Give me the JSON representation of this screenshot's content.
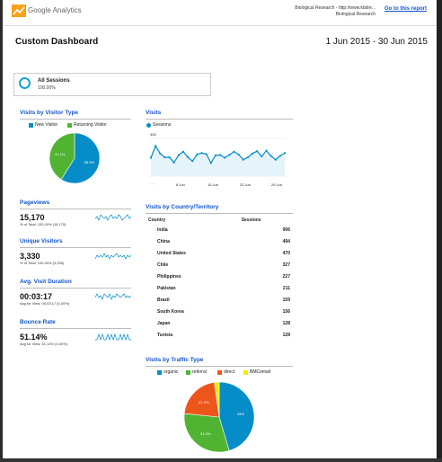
{
  "header": {
    "brand": "Google Analytics",
    "source_line1": "Biological Research - http://www.kbdre...",
    "source_line2": "Biological Research",
    "goto_link": "Go to this report"
  },
  "dashboard": {
    "title": "Custom Dashboard",
    "date_range": "1 Jun 2015 - 30 Jun 2015"
  },
  "segment": {
    "label": "All Sessions",
    "pct": "100.00%"
  },
  "visits_by_visitor_type": {
    "title": "Visits by Visitor Type",
    "legend": [
      "New Visitor",
      "Returning Visitor"
    ],
    "slice_labels": [
      "58.9%",
      "41.1%"
    ]
  },
  "visits": {
    "title": "Visits",
    "legend": "Sessions",
    "y_top": "400",
    "x_labels": [
      "8 Jun",
      "15 Jun",
      "22 Jun",
      "29 Jun"
    ],
    "x_dots": "..."
  },
  "metrics": [
    {
      "title": "Pageviews",
      "value": "15,170",
      "sub": "% of Total: 100.00% (15,170)"
    },
    {
      "title": "Unique Visitors",
      "value": "3,330",
      "sub": "% of Total: 100.00% (3,330)"
    },
    {
      "title": "Avg. Visit Duration",
      "value": "00:03:17",
      "sub": "Avg for View: 00:03:17 (0.00%)"
    },
    {
      "title": "Bounce Rate",
      "value": "51.14%",
      "sub": "Avg for View: 51.14% (0.00%)"
    }
  ],
  "country_table": {
    "title": "Visits by Country/Territory",
    "headers": [
      "Country",
      "Sessions"
    ],
    "rows": [
      [
        "India",
        "906"
      ],
      [
        "China",
        "494"
      ],
      [
        "United States",
        "470"
      ],
      [
        "Chile",
        "327"
      ],
      [
        "Philippines",
        "227"
      ],
      [
        "Pakistan",
        "211"
      ],
      [
        "Brazil",
        "159"
      ],
      [
        "South Korea",
        "156"
      ],
      [
        "Japan",
        "128"
      ],
      [
        "Tunisia",
        "128"
      ]
    ]
  },
  "traffic_type": {
    "title": "Visits by Traffic Type",
    "legend": [
      "organic",
      "referral",
      "direct",
      "BMCemail"
    ],
    "slice_labels": [
      "43%",
      "31.2%",
      "21.2%"
    ]
  },
  "chart_data": [
    {
      "type": "pie",
      "title": "Visits by Visitor Type",
      "categories": [
        "New Visitor",
        "Returning Visitor"
      ],
      "values": [
        58.9,
        41.1
      ],
      "colors": [
        "#058dc7",
        "#50b432"
      ]
    },
    {
      "type": "line",
      "title": "Visits",
      "series": [
        {
          "name": "Sessions",
          "values": [
            195,
            320,
            240,
            200,
            200,
            145,
            225,
            260,
            200,
            160,
            230,
            245,
            235,
            140,
            220,
            225,
            195,
            225,
            260,
            230,
            175,
            200,
            240,
            265,
            210,
            270,
            215,
            175,
            215,
            245
          ]
        }
      ],
      "ylim": [
        0,
        400
      ],
      "x_tick_labels": [
        "8 Jun",
        "15 Jun",
        "22 Jun",
        "29 Jun"
      ],
      "color": "#058dc7"
    },
    {
      "type": "pie",
      "title": "Visits by Traffic Type",
      "categories": [
        "organic",
        "referral",
        "direct",
        "BMCemail"
      ],
      "values": [
        45.4,
        31.2,
        21.2,
        2.2
      ],
      "colors": [
        "#058dc7",
        "#50b432",
        "#ed561b",
        "#edef00"
      ]
    }
  ],
  "sparklines": {
    "color": "#058dc7",
    "pageviews": [
      5,
      6,
      4,
      7,
      6,
      5,
      6,
      4,
      6,
      7,
      5,
      6,
      5,
      7,
      6,
      4,
      5,
      6,
      7,
      5,
      6
    ],
    "unique": [
      4,
      6,
      5,
      6,
      5,
      7,
      5,
      6,
      4,
      6,
      5,
      6,
      7,
      5,
      6,
      5,
      6,
      4,
      6,
      5,
      6
    ],
    "duration": [
      5,
      7,
      5,
      6,
      4,
      7,
      6,
      5,
      7,
      4,
      6,
      5,
      7,
      6,
      5,
      6,
      7,
      5,
      6,
      5,
      6
    ],
    "bounce": [
      5,
      5,
      6,
      5,
      6,
      5,
      5,
      6,
      5,
      6,
      5,
      6,
      5,
      5,
      6,
      5,
      6,
      5,
      6,
      5,
      5
    ]
  }
}
